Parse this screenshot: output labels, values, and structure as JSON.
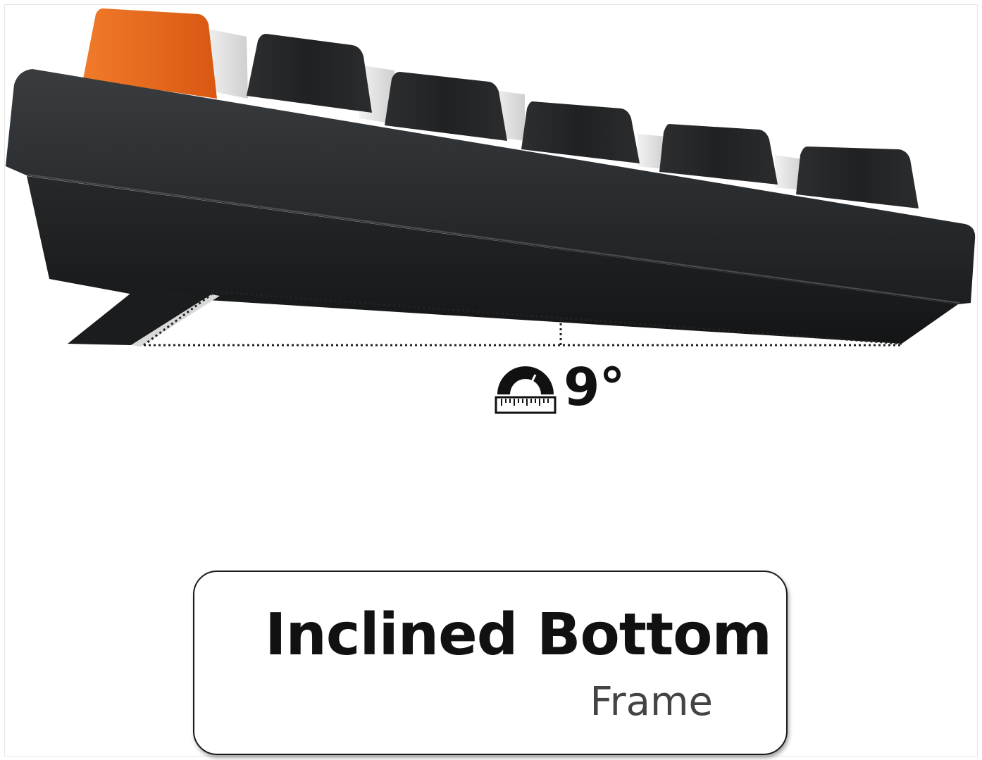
{
  "angle": {
    "icon": "protractor-icon",
    "value": "9°"
  },
  "caption": {
    "title": "Inclined Bottom",
    "subtitle": "Frame"
  },
  "colors": {
    "accent_keycap": "#e8641c",
    "case": "#1d1f21",
    "keycap_dark": "#222426",
    "keycap_light": "#e4e4e4",
    "dotted_line": "#222222"
  }
}
